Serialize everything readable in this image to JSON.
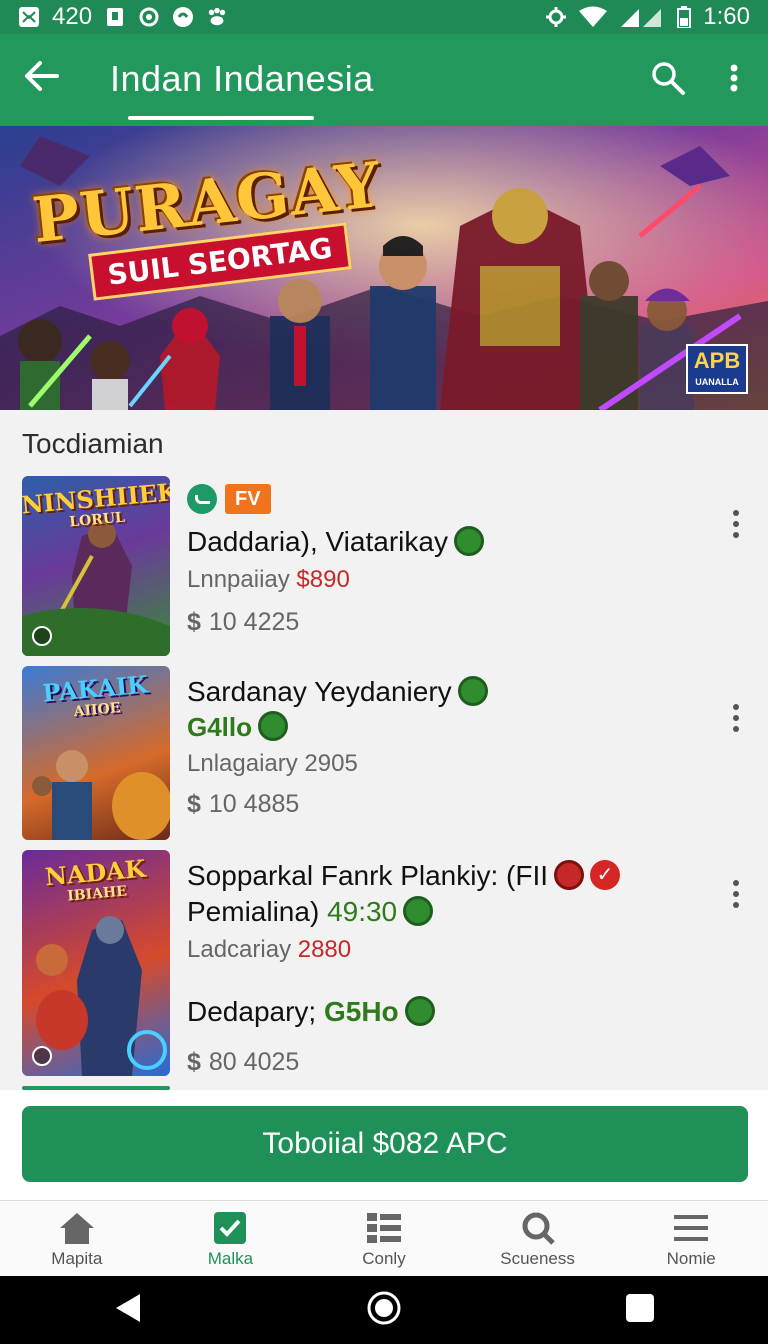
{
  "status_bar": {
    "left_text": "420",
    "time": "1:60",
    "icons": [
      "notification-icon",
      "reader-icon",
      "sync-icon",
      "chat-icon",
      "paw-icon",
      "settings-icon",
      "wifi-icon",
      "signal-icon",
      "battery-icon"
    ]
  },
  "appbar": {
    "title": "Indan Indanesia",
    "back_icon": "arrow-left-icon",
    "search_icon": "search-icon",
    "more_icon": "more-vert-icon"
  },
  "banner": {
    "title": "PURAGAY",
    "subtitle": "SUIL SEORTAG",
    "badge": "APB",
    "badge_sub": "UANALLA"
  },
  "section": {
    "title": "Tocdiamian"
  },
  "items": [
    {
      "thumb_title": "NINSHIIEK",
      "thumb_sub": "LORUL",
      "tag_fv": "FV",
      "title": "Daddaria), Viatarikay",
      "sub_label": "Lnnpaiiay",
      "sub_value": "$890",
      "price_symbol": "$",
      "price": "10 4225"
    },
    {
      "thumb_title": "PAKAIK",
      "thumb_sub": "AIIOE",
      "title": "Sardanay Yeydaniery",
      "green_value": "G4llo",
      "sub_label": "Lnlagaiary 2905",
      "price_symbol": "$",
      "price": "10 4885"
    },
    {
      "thumb_title": "NADAK",
      "thumb_sub": "IBIAHE",
      "title": "Sopparkal Fanrk Plankiy: (FII",
      "line2_label": "Pemialina)",
      "line2_value": "49:30",
      "sub_label": "Ladcariay",
      "sub_value": "2880",
      "extra_label": "Dedapary;",
      "extra_value": "G5Ho",
      "price_symbol": "$",
      "price": "80 4025"
    }
  ],
  "cta": {
    "label": "Toboiial $082 APC"
  },
  "bottom_nav": [
    {
      "label": "Mapita",
      "icon": "home-icon"
    },
    {
      "label": "Malka",
      "icon": "check-box-icon"
    },
    {
      "label": "Conly",
      "icon": "list-icon"
    },
    {
      "label": "Scueness",
      "icon": "search-icon"
    },
    {
      "label": "Nomie",
      "icon": "menu-icon"
    }
  ],
  "colors": {
    "primary": "#22985d",
    "status_bar": "#1f8a55",
    "cta": "#1f9158",
    "accent_orange": "#f0731e",
    "price_red": "#c62828",
    "coin_green": "#2f8c2f"
  }
}
